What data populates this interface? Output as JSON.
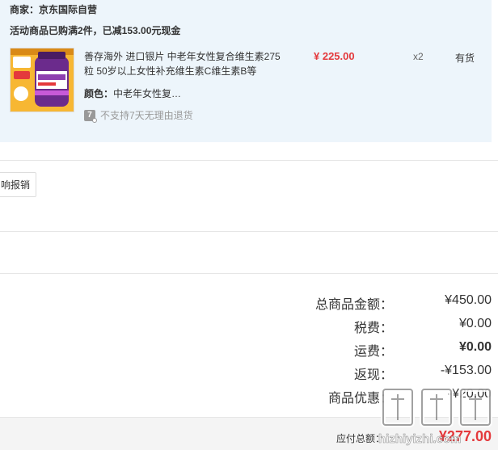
{
  "shop": {
    "merchant_label": "商家：京东国际自营",
    "promo_label": "活动商品已购满2件，已减153.00元现金"
  },
  "product": {
    "image_alt": "Centrum multivitamin bottle",
    "name": "善存海外 进口银片 中老年女性复合维生素275粒 50岁以上女性补充维生素C维生素B等",
    "price": "¥ 225.00",
    "quantity": "x2",
    "stock": "有货",
    "color_key": "颜色：",
    "color_value": "中老年女性复…",
    "no_return_icon": "7",
    "no_return_text": "不支持7天无理由退货"
  },
  "actions": {
    "report_button": "响报销"
  },
  "summary": {
    "rows": [
      {
        "label": "总商品金额：",
        "value": "¥450.00"
      },
      {
        "label": "税费：",
        "value": "¥0.00"
      },
      {
        "label": "运费：",
        "value": "¥0.00"
      },
      {
        "label": "返现：",
        "value": "-¥153.00"
      },
      {
        "label": "商品优惠：",
        "value": "-¥20.00"
      }
    ],
    "payable_label": "应付总额：",
    "payable_value": "¥277.00"
  },
  "watermark": {
    "text": "hizhiyizhi.com"
  }
}
